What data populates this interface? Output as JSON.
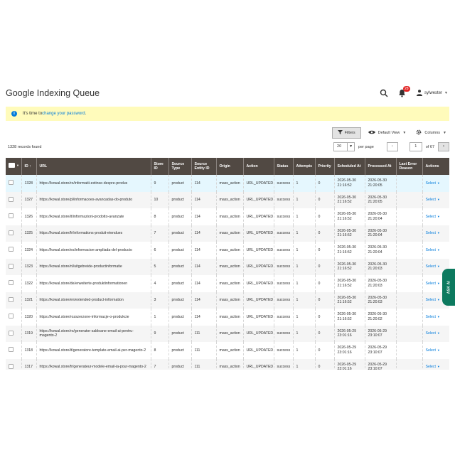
{
  "page": {
    "title": "Google Indexing Queue"
  },
  "header": {
    "notification_count": "28",
    "username": "sylwester"
  },
  "message": {
    "text": "It's time to ",
    "link": "change your password",
    "suffix": "."
  },
  "toolbar": {
    "filters_label": "Filters",
    "view_label": "Default View",
    "columns_label": "Columns",
    "records_found": "1328 records found",
    "per_page_value": "20",
    "per_page_label": "per page",
    "current_page": "1",
    "total_pages": "of 67"
  },
  "columns": [
    "",
    "ID",
    "URL",
    "Store ID",
    "Source Type",
    "Source Entity ID",
    "Origin",
    "Action",
    "Status",
    "Attempts",
    "Priority",
    "Scheduled At",
    "Processed At",
    "Last Error Reason",
    "Actions"
  ],
  "rows": [
    {
      "id": "1328",
      "url": "https://kowal.store/ro/informatii-extinse-despre-produs",
      "store": "9",
      "type": "product",
      "entity": "114",
      "origin": "mass_action",
      "action": "URL_UPDATED",
      "status": "success",
      "attempts": "1",
      "priority": "0",
      "scheduled": "2026-05-30 21:16:52",
      "processed": "2026-05-30 21:20:05",
      "error": "",
      "actions": "Select"
    },
    {
      "id": "1327",
      "url": "https://kowal.store/pl/informacoes-avancadas-do-produto",
      "store": "10",
      "type": "product",
      "entity": "114",
      "origin": "mass_action",
      "action": "URL_UPDATED",
      "status": "success",
      "attempts": "1",
      "priority": "0",
      "scheduled": "2026-05-30 21:16:52",
      "processed": "2026-05-30 21:20:05",
      "error": "",
      "actions": "Select"
    },
    {
      "id": "1326",
      "url": "https://kowal.store/it/informazioni-prodotto-avanzate",
      "store": "8",
      "type": "product",
      "entity": "114",
      "origin": "mass_action",
      "action": "URL_UPDATED",
      "status": "success",
      "attempts": "1",
      "priority": "0",
      "scheduled": "2026-05-30 21:16:52",
      "processed": "2026-05-30 21:20:04",
      "error": "",
      "actions": "Select"
    },
    {
      "id": "1325",
      "url": "https://kowal.store/fr/informations-produit-etendues",
      "store": "7",
      "type": "product",
      "entity": "114",
      "origin": "mass_action",
      "action": "URL_UPDATED",
      "status": "success",
      "attempts": "1",
      "priority": "0",
      "scheduled": "2026-05-30 21:16:52",
      "processed": "2026-05-30 21:20:04",
      "error": "",
      "actions": "Select"
    },
    {
      "id": "1324",
      "url": "https://kowal.store/es/informacion-ampliada-del-producto",
      "store": "6",
      "type": "product",
      "entity": "114",
      "origin": "mass_action",
      "action": "URL_UPDATED",
      "status": "success",
      "attempts": "1",
      "priority": "0",
      "scheduled": "2026-05-30 21:16:52",
      "processed": "2026-05-30 21:20:04",
      "error": "",
      "actions": "Select"
    },
    {
      "id": "1323",
      "url": "https://kowal.store/nl/uitgebreide-productinformatie",
      "store": "5",
      "type": "product",
      "entity": "114",
      "origin": "mass_action",
      "action": "URL_UPDATED",
      "status": "success",
      "attempts": "1",
      "priority": "0",
      "scheduled": "2026-05-30 21:16:52",
      "processed": "2026-05-30 21:20:03",
      "error": "",
      "actions": "Select"
    },
    {
      "id": "1322",
      "url": "https://kowal.store/de/erweiterte-produktinformationen",
      "store": "4",
      "type": "product",
      "entity": "114",
      "origin": "mass_action",
      "action": "URL_UPDATED",
      "status": "success",
      "attempts": "1",
      "priority": "0",
      "scheduled": "2026-05-30 21:16:52",
      "processed": "2026-05-30 21:20:03",
      "error": "",
      "actions": "Select"
    },
    {
      "id": "1321",
      "url": "https://kowal.store/en/extended-product-information",
      "store": "3",
      "type": "product",
      "entity": "114",
      "origin": "mass_action",
      "action": "URL_UPDATED",
      "status": "success",
      "attempts": "1",
      "priority": "0",
      "scheduled": "2026-05-30 21:16:52",
      "processed": "2026-05-30 21:20:03",
      "error": "",
      "actions": "Select"
    },
    {
      "id": "1320",
      "url": "https://kowal.store/rozszerzone-informacje-o-produkcie",
      "store": "1",
      "type": "product",
      "entity": "114",
      "origin": "mass_action",
      "action": "URL_UPDATED",
      "status": "success",
      "attempts": "1",
      "priority": "0",
      "scheduled": "2026-05-30 21:16:52",
      "processed": "2026-05-30 21:20:02",
      "error": "",
      "actions": "Select"
    },
    {
      "id": "1319",
      "url": "https://kowal.store/ro/generator-sabloane-email-ai-pentru-magento-2",
      "store": "9",
      "type": "product",
      "entity": "111",
      "origin": "mass_action",
      "action": "URL_UPDATED",
      "status": "success",
      "attempts": "1",
      "priority": "0",
      "scheduled": "2026-05-29 23:01:16",
      "processed": "2026-05-29 23:10:07",
      "error": "",
      "actions": "Select"
    },
    {
      "id": "1318",
      "url": "https://kowal.store/it/generatore-template-email-ai-per-magento-2",
      "store": "8",
      "type": "product",
      "entity": "111",
      "origin": "mass_action",
      "action": "URL_UPDATED",
      "status": "success",
      "attempts": "1",
      "priority": "0",
      "scheduled": "2026-05-29 23:01:16",
      "processed": "2026-05-29 23:10:07",
      "error": "",
      "actions": "Select"
    },
    {
      "id": "1317",
      "url": "https://kowal.store/fr/generateur-modele-email-ia-pour-magento-2",
      "store": "7",
      "type": "product",
      "entity": "111",
      "origin": "mass_action",
      "action": "URL_UPDATED",
      "status": "success",
      "attempts": "1",
      "priority": "0",
      "scheduled": "2026-05-29 23:01:16",
      "processed": "2026-05-29 23:10:07",
      "error": "",
      "actions": "Select"
    }
  ],
  "ask_ai": "ASK AI",
  "colors": {
    "header_bg": "#514943",
    "link": "#007bdb",
    "notice_bg": "#fffbbb",
    "ask_ai_bg": "#0d7a5f"
  },
  "icons": [
    "search-icon",
    "bell-icon",
    "user-icon",
    "info-icon",
    "filter-icon",
    "eye-icon",
    "gear-icon"
  ]
}
